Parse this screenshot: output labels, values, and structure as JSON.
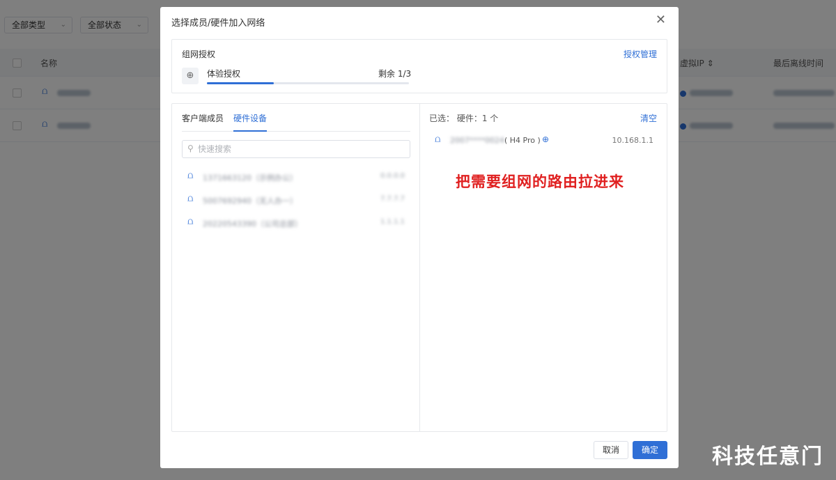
{
  "background": {
    "filters": [
      {
        "label": "全部类型"
      },
      {
        "label": "全部状态"
      }
    ],
    "table": {
      "columns": [
        "名称",
        "虚拟IP",
        "最后离线时间"
      ]
    }
  },
  "dialog": {
    "title": "选择成员/硬件加入网络",
    "license": {
      "section_title": "组网授权",
      "manage_link": "授权管理",
      "plan_name": "体验授权",
      "remaining": "剩余 1/3",
      "usage_fraction": 0.33
    },
    "tabs": [
      {
        "label": "客户端成员",
        "active": false
      },
      {
        "label": "硬件设备",
        "active": true
      }
    ],
    "search": {
      "placeholder": "快速搜索"
    },
    "device_list": [
      {
        "name": "1371663120（示例办公）",
        "ip": "0.0.0.0",
        "icon": "router-icon"
      },
      {
        "name": "5007692940（无人办一）",
        "ip": "7.7.7.7",
        "icon": "router-icon"
      },
      {
        "name": "20220543390（公司总部）",
        "ip": "1.1.1.1",
        "icon": "router-icon"
      }
    ],
    "selected": {
      "label": "已选：  硬件：1 个",
      "clear_label": "清空",
      "items": [
        {
          "name": "2007****0024",
          "model": "( H4 Pro )",
          "ip": "10.168.1.1"
        }
      ]
    },
    "annotation": "把需要组网的路由拉进来",
    "buttons": {
      "cancel": "取消",
      "confirm": "确定"
    }
  },
  "watermark": "科技任意门",
  "colors": {
    "accent": "#2f6fd6",
    "annotation": "#e02020",
    "overlay": "rgba(0,0,0,0.5)"
  }
}
